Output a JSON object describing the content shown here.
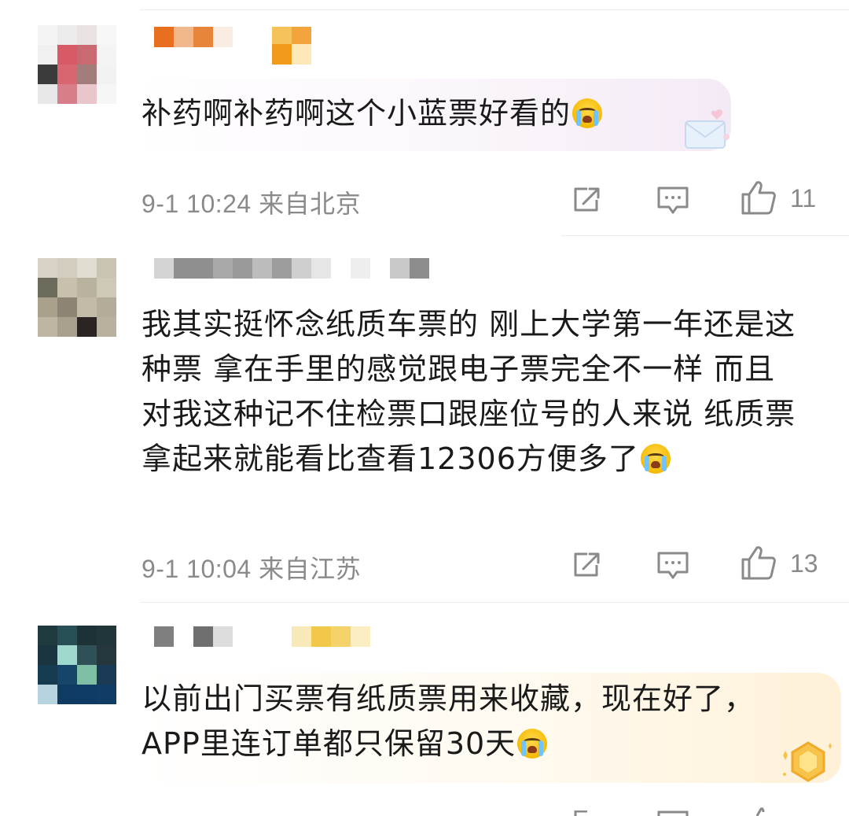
{
  "comments": [
    {
      "text": "补药啊补药啊这个小蓝票好看的",
      "time": "9-1 10:24",
      "location": "来自北京",
      "likes": "11",
      "emoji": "crying-face-emoji"
    },
    {
      "text": "我其实挺怀念纸质车票的 刚上大学第一年还是这种票 拿在手里的感觉跟电子票完全不一样 而且对我这种记不住检票口跟座位号的人来说 纸质票拿起来就能看比查看12306方便多了",
      "time": "9-1 10:04",
      "location": "来自江苏",
      "likes": "13",
      "emoji": "crying-face-emoji"
    },
    {
      "text": "以前出门买票有纸质票用来收藏，现在好了，APP里连订单都只保留30天",
      "emoji": "laugh-cry-face-emoji"
    }
  ],
  "icons": {
    "share": "share-icon",
    "reply": "comment-icon",
    "like": "thumbs-up-icon",
    "badge": "gold-badge-icon"
  },
  "colors": {
    "text": "#1a1a1a",
    "meta": "#8a8a8a",
    "divider": "#ececec",
    "bubble_pink": "#f7eef8",
    "bubble_gold": "#fff4de"
  }
}
